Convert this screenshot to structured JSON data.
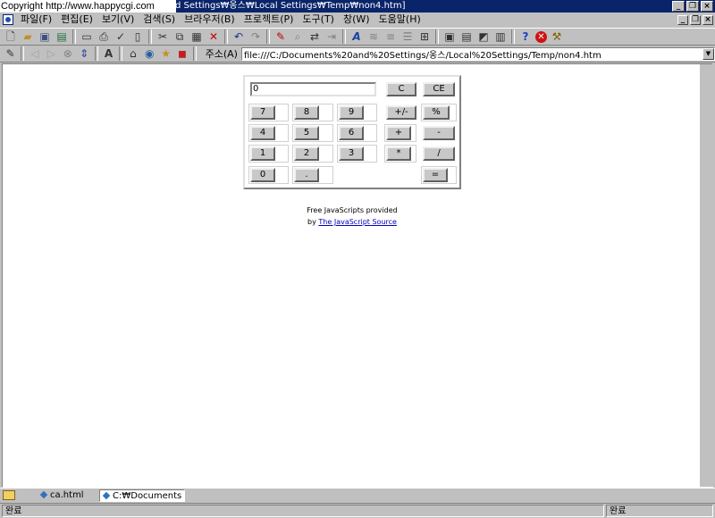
{
  "window": {
    "title": "d Settings₩옹스₩Local Settings₩Temp₩non4.htm]",
    "overlay_text": "Copyright   http://www.happycgi.com",
    "title_bg": "#0a246a"
  },
  "menu": {
    "items": [
      "파일(F)",
      "편집(E)",
      "보기(V)",
      "검색(S)",
      "브라우저(B)",
      "프로젝트(P)",
      "도구(T)",
      "창(W)",
      "도움말(H)"
    ]
  },
  "toolbar": {
    "icons": [
      "new-file-icon",
      "open-folder-icon",
      "save-icon",
      "save-all-icon",
      "print-preview-icon",
      "print-icon",
      "spell-check-icon",
      "page-setup-icon",
      "cut-icon",
      "copy-icon",
      "paste-icon",
      "delete-icon",
      "undo-icon",
      "redo-icon",
      "highlight-icon",
      "find-icon",
      "replace-icon",
      "goto-icon",
      "font-icon",
      "bold-icon",
      "align-icon",
      "list-icon",
      "properties-icon",
      "view1-icon",
      "view2-icon",
      "view3-icon",
      "view4-icon",
      "help-icon",
      "stop-icon",
      "tools-icon"
    ]
  },
  "address": {
    "label": "주소(A)",
    "value": "file:///C:/Documents%20and%20Settings/옹스/Local%20Settings/Temp/non4.htm"
  },
  "calculator": {
    "display": "0",
    "buttons": {
      "c": "C",
      "ce": "CE",
      "n7": "7",
      "n8": "8",
      "n9": "9",
      "plusminus": "+/-",
      "percent": "%",
      "n4": "4",
      "n5": "5",
      "n6": "6",
      "add": "+",
      "subtract": "-",
      "n1": "1",
      "n2": "2",
      "n3": "3",
      "multiply": "*",
      "divide": "/",
      "n0": "0",
      "decimal": ".",
      "equals": "="
    }
  },
  "credit": {
    "line1": "Free JavaScripts provided",
    "by": "by",
    "link": "The JavaScript Source",
    "link_color": "#0000c0"
  },
  "tabs": [
    {
      "label": "ca.html",
      "active": false
    },
    {
      "label": "C:₩Documents an",
      "active": true
    }
  ],
  "status": {
    "left": "완료",
    "right": "완료"
  }
}
